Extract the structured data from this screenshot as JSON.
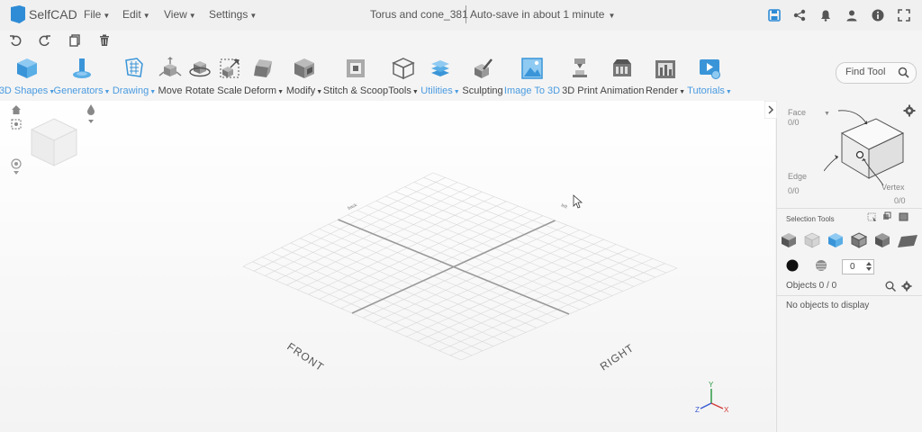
{
  "app": {
    "name": "SelfCAD"
  },
  "menu": {
    "file": "File",
    "edit": "Edit",
    "view": "View",
    "settings": "Settings"
  },
  "document": {
    "title": "Torus and cone_381",
    "autosave": "Auto-save in about 1 minute"
  },
  "toolbar": {
    "tools": [
      {
        "label": "3D Shapes",
        "dropdown": true,
        "highlight": true
      },
      {
        "label": "Generators",
        "dropdown": true,
        "highlight": true
      },
      {
        "label": "Drawing",
        "dropdown": true,
        "highlight": true
      },
      {
        "label": "Move",
        "dropdown": false,
        "highlight": false
      },
      {
        "label": "Rotate",
        "dropdown": false,
        "highlight": false
      },
      {
        "label": "Scale",
        "dropdown": false,
        "highlight": false
      },
      {
        "label": "Deform",
        "dropdown": true,
        "highlight": false
      },
      {
        "label": "Modify",
        "dropdown": true,
        "highlight": false
      },
      {
        "label": "Stitch & Scoop",
        "dropdown": false,
        "highlight": false
      },
      {
        "label": "Tools",
        "dropdown": true,
        "highlight": false
      },
      {
        "label": "Utilities",
        "dropdown": true,
        "highlight": true
      },
      {
        "label": "Sculpting",
        "dropdown": false,
        "highlight": false
      },
      {
        "label": "Image To 3D",
        "dropdown": false,
        "highlight": true
      },
      {
        "label": "3D Print",
        "dropdown": false,
        "highlight": false
      },
      {
        "label": "Animation",
        "dropdown": false,
        "highlight": false
      },
      {
        "label": "Render",
        "dropdown": true,
        "highlight": false
      },
      {
        "label": "Tutorials",
        "dropdown": true,
        "highlight": true
      }
    ],
    "find_tool_placeholder": "Find Tool"
  },
  "viewport": {
    "label_front": "FRONT",
    "label_right": "RIGHT",
    "axis_x": "X",
    "axis_y": "Y",
    "axis_z": "Z"
  },
  "sidebar": {
    "face_label": "Face",
    "face_count": "0/0",
    "edge_label": "Edge",
    "edge_count": "0/0",
    "vertex_label": "Vertex",
    "vertex_count": "0/0",
    "selection_tools": "Selection Tools",
    "stepper_value": "0",
    "objects_label": "Objects 0 / 0",
    "no_objects": "No objects to display"
  },
  "colors": {
    "accent": "#2e8bd6",
    "highlight_text": "#4a9be0"
  }
}
